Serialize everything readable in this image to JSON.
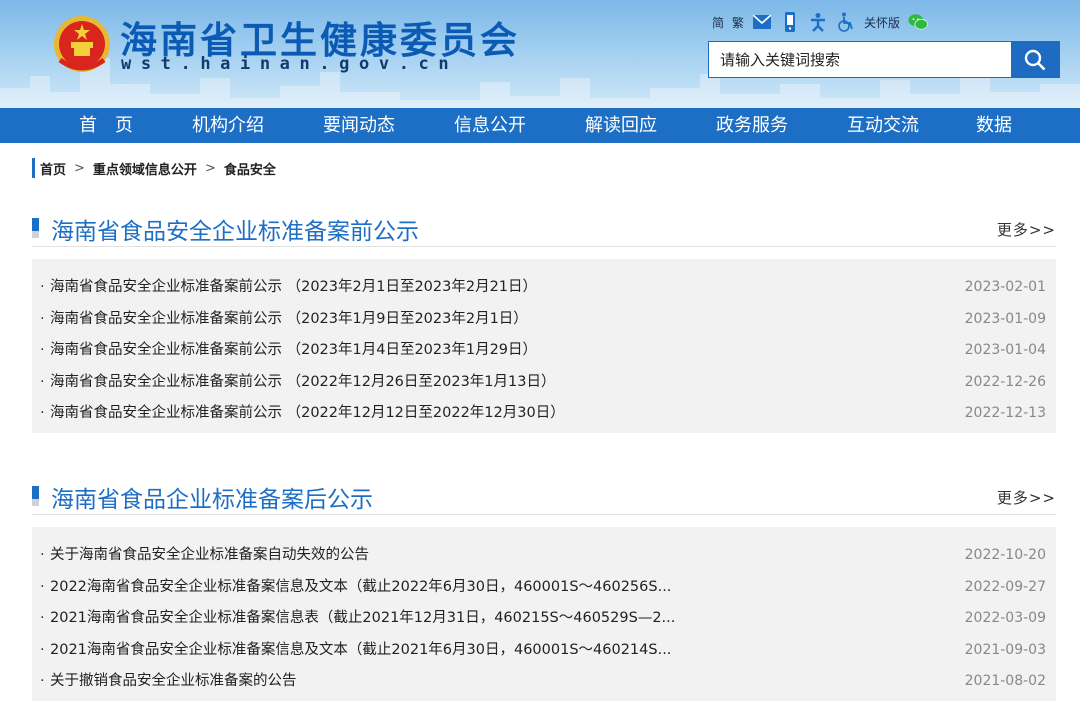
{
  "header": {
    "site_title": "海南省卫生健康委员会",
    "site_url": "wst.hainan.gov.cn",
    "toolbar": {
      "simplified": "简",
      "traditional": "繁",
      "care_version": "关怀版",
      "icons": [
        "mail-icon",
        "mobile-icon",
        "accessibility-org-icon",
        "wheelchair-icon",
        "wechat-icon"
      ]
    },
    "search": {
      "placeholder": "请输入关键词搜索",
      "button_icon": "search-icon"
    }
  },
  "nav": {
    "items": [
      {
        "label": "首　页"
      },
      {
        "label": "机构介绍"
      },
      {
        "label": "要闻动态"
      },
      {
        "label": "信息公开"
      },
      {
        "label": "解读回应"
      },
      {
        "label": "政务服务"
      },
      {
        "label": "互动交流"
      },
      {
        "label": "数据"
      }
    ]
  },
  "breadcrumb": {
    "items": [
      "首页",
      "重点领域信息公开",
      "食品安全"
    ],
    "separator": ">"
  },
  "sections": [
    {
      "title": "海南省食品安全企业标准备案前公示",
      "more": "更多>>",
      "items": [
        {
          "title": "海南省食品安全企业标准备案前公示 （2023年2月1日至2023年2月21日）",
          "date": "2023-02-01"
        },
        {
          "title": "海南省食品安全企业标准备案前公示 （2023年1月9日至2023年2月1日）",
          "date": "2023-01-09"
        },
        {
          "title": "海南省食品安全企业标准备案前公示 （2023年1月4日至2023年1月29日）",
          "date": "2023-01-04"
        },
        {
          "title": "海南省食品安全企业标准备案前公示 （2022年12月26日至2023年1月13日）",
          "date": "2022-12-26"
        },
        {
          "title": "海南省食品安全企业标准备案前公示 （2022年12月12日至2022年12月30日）",
          "date": "2022-12-13"
        }
      ]
    },
    {
      "title": "海南省食品企业标准备案后公示",
      "more": "更多>>",
      "items": [
        {
          "title": "关于海南省食品安全企业标准备案自动失效的公告",
          "date": "2022-10-20"
        },
        {
          "title": "2022海南省食品安全企业标准备案信息及文本（截止2022年6月30日，460001S～460256S...",
          "date": "2022-09-27"
        },
        {
          "title": "2021海南省食品安全企业标准备案信息表（截止2021年12月31日，460215S～460529S—2...",
          "date": "2022-03-09"
        },
        {
          "title": "2021海南省食品安全企业标准备案信息及文本（截止2021年6月30日，460001S～460214S...",
          "date": "2021-09-03"
        },
        {
          "title": "关于撤销食品安全企业标准备案的公告",
          "date": "2021-08-02"
        }
      ]
    }
  ],
  "colors": {
    "brand_blue": "#1d6fc6",
    "title_blue": "#0b5bb5",
    "list_bg": "#f2f2f2",
    "date_gray": "#888888"
  }
}
